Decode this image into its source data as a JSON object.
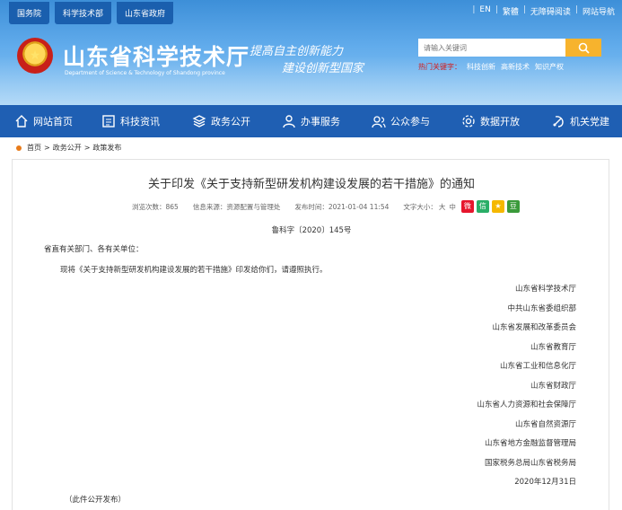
{
  "header": {
    "top_links": [
      "国务院",
      "科学技术部",
      "山东省政府"
    ],
    "right_links": [
      "EN",
      "繁體",
      "无障碍阅读",
      "网站导航"
    ],
    "site_name": "山东省科学技术厅",
    "site_name_en": "Department of Science & Technology of Shandong province",
    "slogan_line1": "提高自主创新能力",
    "slogan_line2": "建设创新型国家",
    "search_placeholder": "请输入关键词",
    "hot_label": "热门关键字：",
    "hot_words": [
      "科技创新",
      "高新技术",
      "知识产权"
    ]
  },
  "nav": {
    "items": [
      {
        "label": "网站首页",
        "icon": "home-icon"
      },
      {
        "label": "科技资讯",
        "icon": "news-icon"
      },
      {
        "label": "政务公开",
        "icon": "layers-icon"
      },
      {
        "label": "办事服务",
        "icon": "user-icon"
      },
      {
        "label": "公众参与",
        "icon": "people-icon"
      },
      {
        "label": "数据开放",
        "icon": "data-icon"
      },
      {
        "label": "机关党建",
        "icon": "party-icon"
      }
    ]
  },
  "breadcrumb": {
    "items": [
      "首页",
      "政务公开",
      "政策发布"
    ],
    "separator": ">"
  },
  "article": {
    "title": "关于印发《关于支持新型研发机构建设发展的若干措施》的通知",
    "views_label": "浏览次数：",
    "views": "865",
    "source_label": "信息来源：",
    "source": "资源配置与管理处",
    "time_label": "发布时间：",
    "time": "2021-01-04 11:54",
    "fontsize_label": "文字大小：",
    "fontsize_large": "大",
    "fontsize_medium": "中",
    "doc_number": "鲁科字〔2020〕145号",
    "salutation": "省直有关部门、各有关单位：",
    "body": "现将《关于支持新型研发机构建设发展的若干措施》印发给你们，请遵照执行。",
    "issuers": [
      "山东省科学技术厅",
      "中共山东省委组织部",
      "山东省发展和改革委员会",
      "山东省教育厅",
      "山东省工业和信息化厅",
      "山东省财政厅",
      "山东省人力资源和社会保障厅",
      "山东省自然资源厅",
      "山东省地方金融监督管理局",
      "国家税务总局山东省税务局"
    ],
    "date": "2020年12月31日",
    "note": "（此件公开发布）"
  },
  "colors": {
    "nav_bg": "#1f5fb3",
    "search_button": "#f7b32d",
    "hot_label": "#d21c1c"
  }
}
